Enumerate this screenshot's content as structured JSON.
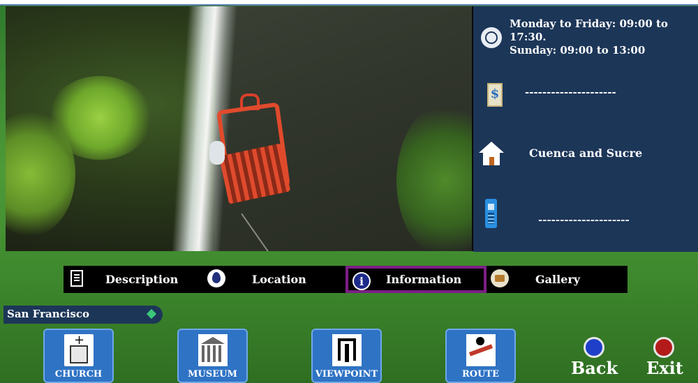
{
  "photo": {
    "icon": "cable-car-waterfall-image"
  },
  "info": {
    "hours": "Monday to Friday: 09:00 to 17:30.\nSunday: 09:00 to 13:00",
    "hours_line1": "Monday to Friday: 09:00 to",
    "hours_line2": "17:30.",
    "hours_line3": "Sunday: 09:00 to 13:00",
    "price": "---------------------",
    "address": "Cuenca and Sucre",
    "phone": "---------------------"
  },
  "tabs": [
    {
      "label": "Description",
      "icon": "document-icon"
    },
    {
      "label": "Location",
      "icon": "map-pin-icon"
    },
    {
      "label": "Information",
      "icon": "info-icon",
      "active": true
    },
    {
      "label": "Gallery",
      "icon": "camera-icon"
    }
  ],
  "location": {
    "name": "San Francisco"
  },
  "nav": [
    {
      "label": "CHURCH",
      "icon": "church-icon"
    },
    {
      "label": "MUSEUM",
      "icon": "museum-icon"
    },
    {
      "label": "VIEWPOINT",
      "icon": "viewpoint-icon"
    },
    {
      "label": "ROUTE",
      "icon": "route-icon"
    }
  ],
  "controls": {
    "back": {
      "label": "Back",
      "color": "#1f3fc9"
    },
    "exit": {
      "label": "Exit",
      "color": "#b31b1b"
    }
  }
}
